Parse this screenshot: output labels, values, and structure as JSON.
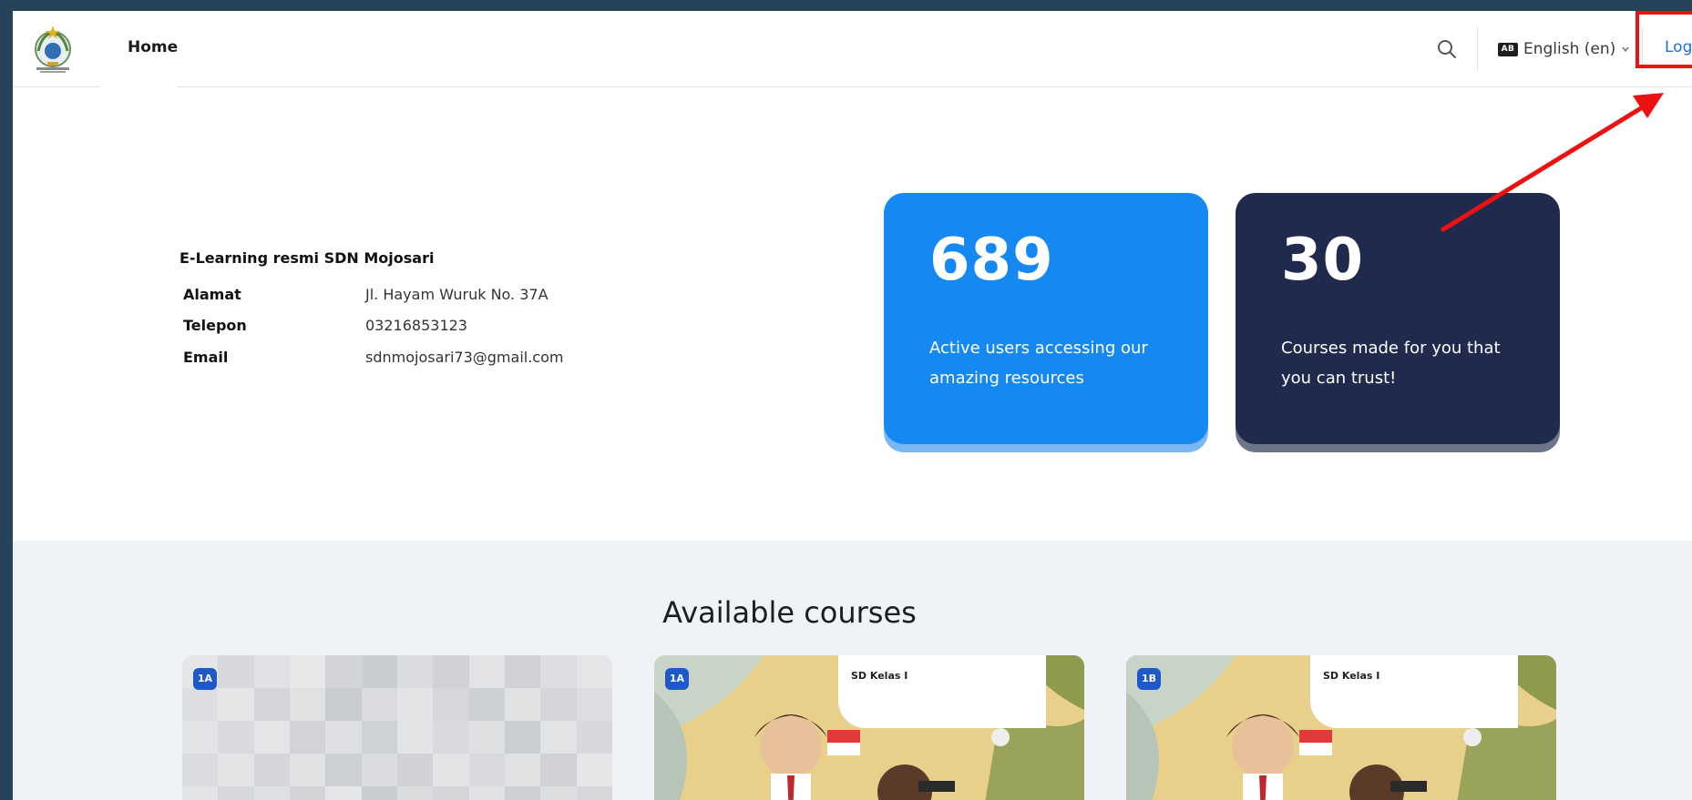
{
  "header": {
    "home_label": "Home",
    "language_label": "English (en)",
    "language_icon_text": "AB",
    "login_label": "Log",
    "icons": [
      "school-logo",
      "search-icon",
      "language-icon",
      "chevron-down-icon"
    ]
  },
  "info": {
    "title": "E-Learning resmi SDN Mojosari",
    "rows": [
      {
        "key": "Alamat",
        "value": "Jl. Hayam Wuruk No. 37A"
      },
      {
        "key": "Telepon",
        "value": "03216853123"
      },
      {
        "key": "Email",
        "value": "sdnmojosari73@gmail.com"
      }
    ]
  },
  "stats": [
    {
      "number": "689",
      "description": "Active users accessing our amazing resources",
      "color": "#1688f2"
    },
    {
      "number": "30",
      "description": "Courses made for you that you can trust!",
      "color": "#1f2a4d"
    }
  ],
  "courses": {
    "title": "Available courses",
    "items": [
      {
        "badge": "1A",
        "label": ""
      },
      {
        "badge": "1A",
        "label": "SD Kelas I"
      },
      {
        "badge": "1B",
        "label": "SD Kelas I"
      }
    ]
  },
  "annotation": {
    "color": "#ee1111"
  }
}
